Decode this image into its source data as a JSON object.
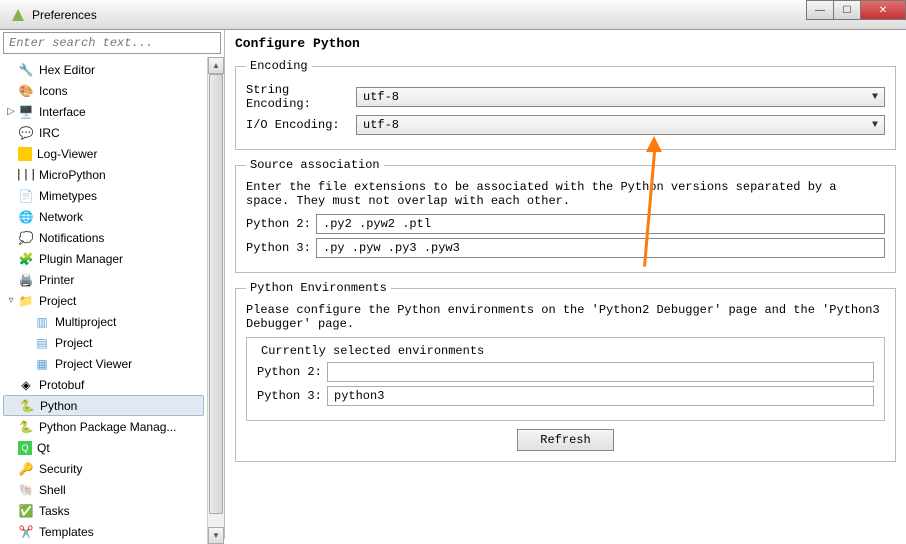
{
  "window": {
    "title": "Preferences"
  },
  "search": {
    "placeholder": "Enter search text..."
  },
  "tree": {
    "i0": "Hex Editor",
    "i1": "Icons",
    "i2": "Interface",
    "i3": "IRC",
    "i4": "Log-Viewer",
    "i5": "MicroPython",
    "i6": "Mimetypes",
    "i7": "Network",
    "i8": "Notifications",
    "i9": "Plugin Manager",
    "i10": "Printer",
    "i11": "Project",
    "i12": "Multiproject",
    "i13": "Project",
    "i14": "Project Viewer",
    "i15": "Protobuf",
    "i16": "Python",
    "i17": "Python Package Manag...",
    "i18": "Qt",
    "i19": "Security",
    "i20": "Shell",
    "i21": "Tasks",
    "i22": "Templates"
  },
  "main": {
    "title": "Configure Python",
    "encoding": {
      "legend": "Encoding",
      "string_label": "String Encoding:",
      "io_label": "I/O Encoding:",
      "string_value": "utf-8",
      "io_value": "utf-8"
    },
    "assoc": {
      "legend": "Source association",
      "help": "Enter the file extensions to be associated with the Python versions separated by a space. They must not overlap with each other.",
      "py2_label": "Python 2:",
      "py3_label": "Python 3:",
      "py2_value": ".py2 .pyw2 .ptl",
      "py3_value": ".py .pyw .py3 .pyw3"
    },
    "env": {
      "legend": "Python Environments",
      "help": "Please configure the Python environments on the 'Python2 Debugger' page and the 'Python3 Debugger' page.",
      "current_label": "Currently selected environments",
      "py2_label": "Python 2:",
      "py3_label": "Python 3:",
      "py2_value": "",
      "py3_value": "python3",
      "refresh": "Refresh"
    }
  }
}
